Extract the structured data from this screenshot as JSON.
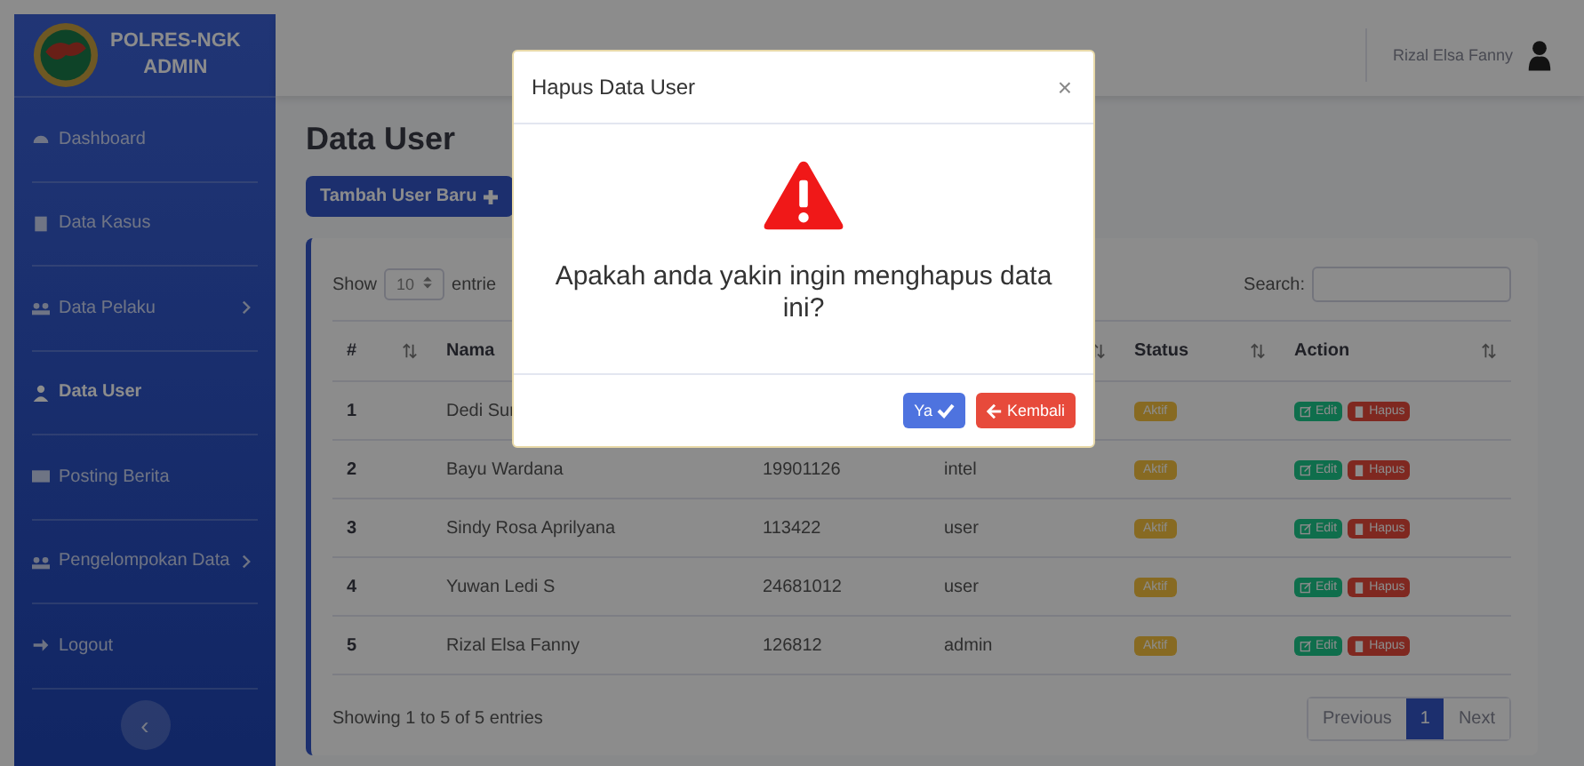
{
  "sidebar": {
    "brand": {
      "line1": "POLRES-NGK",
      "line2": "ADMIN"
    },
    "items": [
      {
        "label": "Dashboard",
        "has_submenu": false,
        "selected": false
      },
      {
        "label": "Data Kasus",
        "has_submenu": false,
        "selected": false
      },
      {
        "label": "Data Pelaku",
        "has_submenu": true,
        "selected": false
      },
      {
        "label": "Data User",
        "has_submenu": false,
        "selected": true
      },
      {
        "label": "Posting Berita",
        "has_submenu": false,
        "selected": false
      },
      {
        "label": "Pengelompokan Data",
        "has_submenu": true,
        "selected": false
      },
      {
        "label": "Logout",
        "has_submenu": false,
        "selected": false
      }
    ],
    "collapse_button": "‹"
  },
  "topbar": {
    "user_name": "Rizal Elsa Fanny"
  },
  "page": {
    "title": "Data User",
    "add_button": "Tambah User Baru"
  },
  "table": {
    "show_label": "Show",
    "page_size": "10",
    "entries_label": "entrie",
    "search_label": "Search:",
    "columns": [
      {
        "label": "#",
        "sortable": true
      },
      {
        "label": "Nama"
      },
      {},
      {
        "sortable": true
      },
      {
        "label": "Status",
        "sortable": true
      },
      {
        "label": "Action",
        "sortable": true
      }
    ],
    "rows": [
      {
        "no": "1",
        "name": "Dedi Sur",
        "status": "Aktif",
        "actions": [
          "Edit",
          "Hapus"
        ]
      },
      {
        "no": "2",
        "name": "Bayu Wardana",
        "column_3": "19901126",
        "column_4": "intel",
        "status": "Aktif",
        "actions": [
          "Edit",
          "Hapus"
        ]
      },
      {
        "no": "3",
        "name": "Sindy Rosa Aprilyana",
        "column_3": "113422",
        "column_4": "user",
        "status": "Aktif",
        "actions": [
          "Edit",
          "Hapus"
        ]
      },
      {
        "no": "4",
        "name": "Yuwan Ledi S",
        "column_3": "24681012",
        "column_4": "user",
        "status": "Aktif",
        "actions": [
          "Edit",
          "Hapus"
        ]
      },
      {
        "no": "5",
        "name": "Rizal Elsa Fanny",
        "column_3": "126812",
        "column_4": "admin",
        "status": "Aktif",
        "actions": [
          "Edit",
          "Hapus"
        ]
      }
    ],
    "info": "Showing 1 to 5 of 5 entries",
    "pagination": [
      {
        "label": "Previous",
        "kind": "nav",
        "selected": false
      },
      {
        "label": "1",
        "kind": "page",
        "selected": true
      },
      {
        "label": "Next",
        "kind": "nav",
        "selected": false
      }
    ]
  },
  "modal": {
    "title": "Hapus Data User",
    "close": "×",
    "message": "Apakah anda yakin ingin menghapus data ini?",
    "confirm_button": "Ya",
    "cancel_button": "Kembali"
  }
}
